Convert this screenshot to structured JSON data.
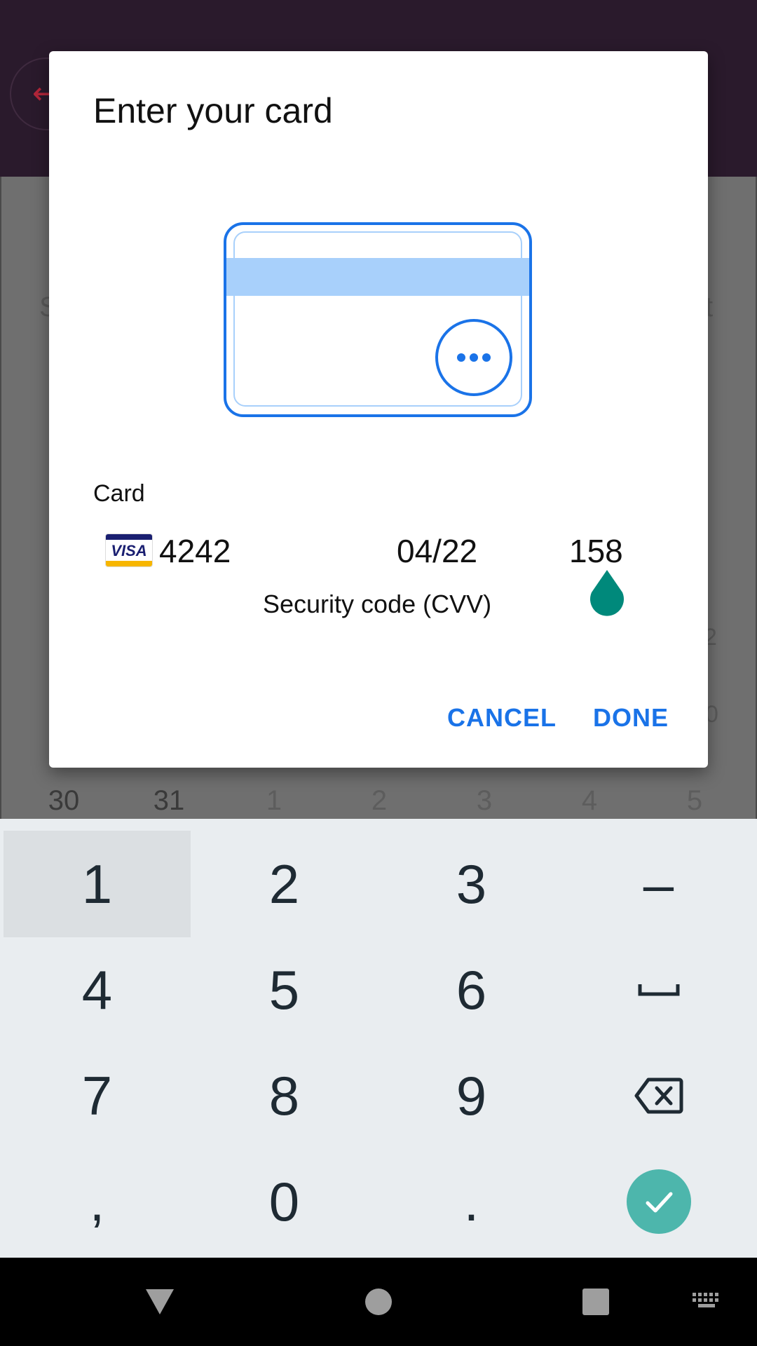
{
  "dialog": {
    "title": "Enter your card",
    "card_label": "Card",
    "card_brand": "VISA",
    "card_number": "4242",
    "card_expiry": "04/22",
    "card_cvv": "158",
    "cvv_hint": "Security code (CVV)",
    "cancel_label": "CANCEL",
    "done_label": "DONE"
  },
  "background": {
    "left_peek": "S",
    "right_peek": "t",
    "side_peek_1": "2",
    "side_peek_2": "0",
    "calendar_days": [
      "30",
      "31",
      "1",
      "2",
      "3",
      "4",
      "5"
    ]
  },
  "keyboard": {
    "rows": [
      [
        "1",
        "2",
        "3",
        "–"
      ],
      [
        "4",
        "5",
        "6",
        "space"
      ],
      [
        "7",
        "8",
        "9",
        "backspace"
      ],
      [
        ",",
        "0",
        ".",
        "enter"
      ]
    ],
    "key_labels": {
      "k1": "1",
      "k2": "2",
      "k3": "3",
      "dash": "–",
      "k4": "4",
      "k5": "5",
      "k6": "6",
      "k7": "7",
      "k8": "8",
      "k9": "9",
      "comma": ",",
      "k0": "0",
      "period": "."
    },
    "enter_color": "#4db6ac"
  },
  "colors": {
    "accent": "#1a73e8",
    "card_outline": "#1a73e8",
    "card_stripe": "#a8d0fb",
    "cursor_handle": "#00897b"
  },
  "navbar": {
    "icons": [
      "back-icon",
      "home-icon",
      "recents-icon",
      "keyboard-icon"
    ]
  }
}
